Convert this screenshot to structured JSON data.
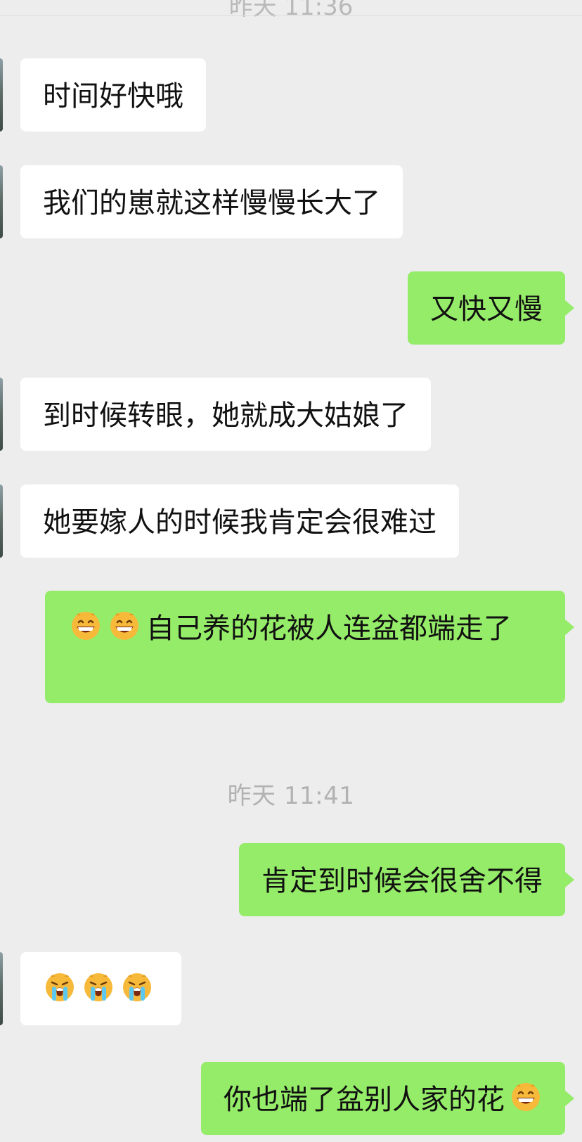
{
  "chat": {
    "top_time_partial": "昨天 11:36",
    "messages": [
      {
        "side": "left",
        "text": "时间好快哦"
      },
      {
        "side": "left",
        "text": "我们的崽就这样慢慢长大了"
      },
      {
        "side": "right",
        "text": "又快又慢"
      },
      {
        "side": "left",
        "text": "到时候转眼，她就成大姑娘了"
      },
      {
        "side": "left",
        "text": "她要嫁人的时候我肯定会很难过"
      },
      {
        "side": "right",
        "text": "自己养的花被人连盆都端走了",
        "emoji_before": [
          "grin-icon",
          "grin-icon"
        ]
      },
      {
        "side": "right",
        "text": "肯定到时候会很舍不得"
      },
      {
        "side": "left",
        "text": "",
        "emoji_before": [
          "crying-icon",
          "crying-icon",
          "crying-icon"
        ]
      },
      {
        "side": "right",
        "text": "你也端了盆别人家的花",
        "emoji_after": [
          "grin-icon"
        ]
      }
    ],
    "time_separator": "昨天 11:41"
  },
  "colors": {
    "background": "#ededed",
    "bubble_sent": "#95ec69",
    "bubble_received": "#ffffff",
    "timestamp": "#b2b2b2"
  }
}
